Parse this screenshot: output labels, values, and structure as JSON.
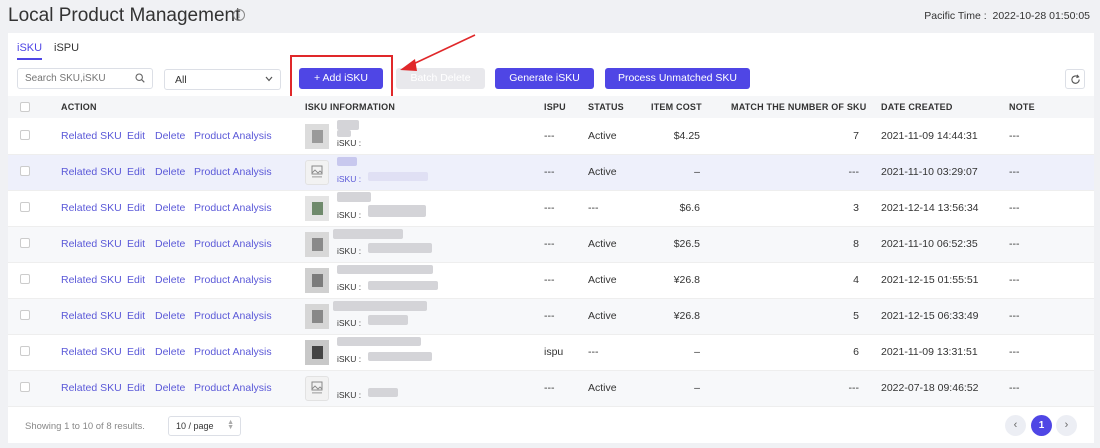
{
  "header": {
    "title": "Local Product Management",
    "pacific_time": "Pacific Time :  2022-10-28 01:50:05"
  },
  "tabs": [
    {
      "label": "iSKU",
      "active": true
    },
    {
      "label": "iSPU",
      "active": false
    }
  ],
  "toolbar": {
    "search_placeholder": "Search SKU,iSKU",
    "select_value": "All",
    "add_label": "+ Add iSKU",
    "batch_delete_label": "Batch Delete",
    "generate_label": "Generate iSKU",
    "process_label": "Process Unmatched SKU"
  },
  "columns": {
    "action": "ACTION",
    "isku_info": "ISKU INFORMATION",
    "ispu": "ISPU",
    "status": "STATUS",
    "item_cost": "ITEM COST",
    "match": "MATCH THE NUMBER OF SKU",
    "date_created": "DATE CREATED",
    "note": "NOTE"
  },
  "actions": {
    "related": "Related SKU",
    "edit": "Edit",
    "delete": "Delete",
    "analysis": "Product Analysis"
  },
  "isku_label": "iSKU :",
  "rows": [
    {
      "ispu": "---",
      "status": "Active",
      "cost": "$4.25",
      "match": "7",
      "date": "2021-11-09 14:44:31",
      "note": "---"
    },
    {
      "ispu": "---",
      "status": "Active",
      "cost": "–",
      "match": "---",
      "date": "2021-11-10 03:29:07",
      "note": "---"
    },
    {
      "ispu": "---",
      "status": "---",
      "cost": "$6.6",
      "match": "3",
      "date": "2021-12-14 13:56:34",
      "note": "---"
    },
    {
      "ispu": "---",
      "status": "Active",
      "cost": "$26.5",
      "match": "8",
      "date": "2021-11-10 06:52:35",
      "note": "---"
    },
    {
      "ispu": "---",
      "status": "Active",
      "cost": "¥26.8",
      "match": "4",
      "date": "2021-12-15 01:55:51",
      "note": "---"
    },
    {
      "ispu": "---",
      "status": "Active",
      "cost": "¥26.8",
      "match": "5",
      "date": "2021-12-15 06:33:49",
      "note": "---"
    },
    {
      "ispu": "ispu",
      "status": "---",
      "cost": "–",
      "match": "6",
      "date": "2021-11-09 13:31:51",
      "note": "---"
    },
    {
      "ispu": "---",
      "status": "Active",
      "cost": "–",
      "match": "---",
      "date": "2022-07-18 09:46:52",
      "note": "---"
    }
  ],
  "footer": {
    "showing": "Showing 1 to 10 of 8 results.",
    "page_size": "10 / page",
    "current_page": "1"
  },
  "colors": {
    "primary": "#4f46e5",
    "link": "#5b59d8",
    "highlight": "#e0282a"
  }
}
